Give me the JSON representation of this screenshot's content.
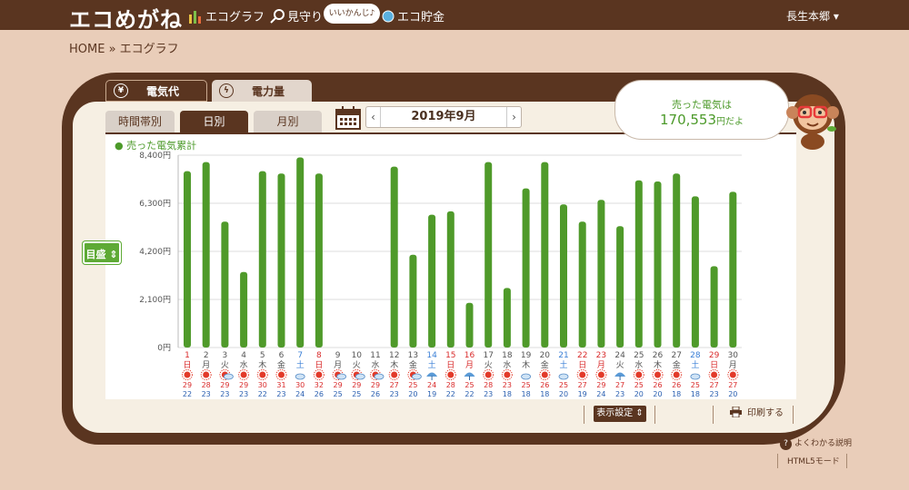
{
  "header": {
    "logo": "エコめがね",
    "nav": [
      {
        "label": "エコグラフ",
        "icon": "bar-chart-icon"
      },
      {
        "label": "見守り",
        "icon": "magnifier-icon"
      },
      {
        "label": "エコ貯金",
        "icon": "coin-icon"
      }
    ],
    "badge": "いいかんじ♪",
    "user": "長生本郷 ▾"
  },
  "breadcrumb": "HOME » エコグラフ",
  "tabs": [
    {
      "label": "電気代",
      "icon_text": "¥",
      "active": true
    },
    {
      "label": "電力量",
      "icon_text": "ϟ",
      "active": false
    }
  ],
  "segments": [
    {
      "label": "時間帯別",
      "active": false
    },
    {
      "label": "日別",
      "active": true
    },
    {
      "label": "月別",
      "active": false
    }
  ],
  "date": {
    "label": "2019年9月",
    "prev": "‹",
    "next": "›"
  },
  "legend": "● 売った電気累計",
  "goal_button": "目盛 ⇕",
  "bubble": {
    "line1": "売った電気は",
    "amount": "170,553",
    "suffix": "円だよ"
  },
  "buttons": {
    "display_settings": "表示設定 ⇕",
    "print": "印刷する"
  },
  "help": "よくわかる説明",
  "html5": "HTML5モード",
  "colors": {
    "bar": "#4f9a2a",
    "brown": "#5a3520",
    "sunday": "#d92b2b",
    "saturday": "#3a7fd6"
  },
  "chart_data": {
    "type": "bar",
    "ylim": [
      0,
      8400
    ],
    "yticks": [
      "0円",
      "2,100円",
      "4,200円",
      "6,300円",
      "8,400円"
    ],
    "categories": [
      "1",
      "2",
      "3",
      "4",
      "5",
      "6",
      "7",
      "8",
      "9",
      "10",
      "11",
      "12",
      "13",
      "14",
      "15",
      "16",
      "17",
      "18",
      "19",
      "20",
      "21",
      "22",
      "23",
      "24",
      "25",
      "26",
      "27",
      "28",
      "29",
      "30"
    ],
    "weekdays": [
      "日",
      "月",
      "火",
      "水",
      "木",
      "金",
      "土",
      "日",
      "月",
      "火",
      "水",
      "木",
      "金",
      "土",
      "日",
      "月",
      "火",
      "水",
      "木",
      "金",
      "土",
      "日",
      "月",
      "火",
      "水",
      "木",
      "金",
      "土",
      "日",
      "月"
    ],
    "day_type": [
      "sun",
      "wk",
      "wk",
      "wk",
      "wk",
      "wk",
      "sat",
      "sun",
      "wk",
      "wk",
      "wk",
      "wk",
      "wk",
      "sat",
      "sun",
      "hol",
      "wk",
      "wk",
      "wk",
      "wk",
      "sat",
      "hol",
      "hol",
      "wk",
      "wk",
      "wk",
      "wk",
      "sat",
      "sun",
      "wk"
    ],
    "values": [
      7700,
      8100,
      5500,
      3300,
      7700,
      7600,
      8300,
      7600,
      null,
      null,
      null,
      7900,
      4050,
      5800,
      5950,
      1950,
      8100,
      2600,
      6950,
      8100,
      6250,
      5500,
      6450,
      5300,
      7300,
      7250,
      7600,
      6600,
      3550,
      6800
    ],
    "weather": [
      "sun",
      "sun",
      "sun-cloud",
      "sun",
      "sun",
      "sun",
      "cloud",
      "sun",
      "sun-cloud",
      "sun-cloud",
      "sun-cloud",
      "sun",
      "sun-cloud",
      "umbrella",
      "sun",
      "umbrella",
      "sun",
      "sun",
      "cloud",
      "sun",
      "cloud",
      "sun",
      "sun",
      "umbrella",
      "sun",
      "sun",
      "sun",
      "cloud",
      "sun",
      "sun"
    ],
    "temp_high": [
      "29",
      "28",
      "29",
      "29",
      "30",
      "31",
      "30",
      "32",
      "29",
      "29",
      "29",
      "27",
      "25",
      "24",
      "28",
      "25",
      "28",
      "23",
      "25",
      "26",
      "25",
      "27",
      "29",
      "27",
      "25",
      "26",
      "26",
      "25",
      "27",
      "27"
    ],
    "temp_low": [
      "22",
      "23",
      "23",
      "23",
      "22",
      "23",
      "24",
      "26",
      "25",
      "25",
      "26",
      "23",
      "20",
      "19",
      "22",
      "22",
      "23",
      "18",
      "18",
      "18",
      "20",
      "19",
      "24",
      "23",
      "20",
      "20",
      "18",
      "18",
      "23",
      "20"
    ]
  }
}
